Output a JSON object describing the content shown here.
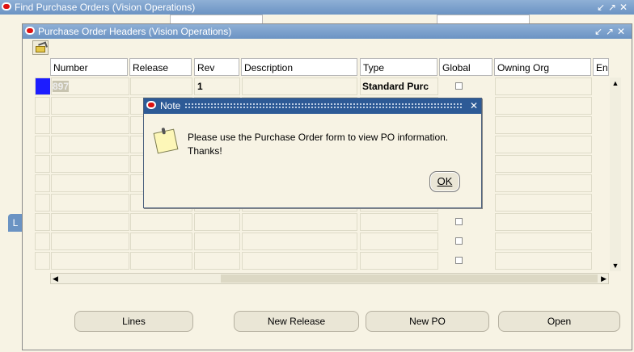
{
  "find_window": {
    "title": "Find Purchase Orders (Vision Operations)",
    "partial_value": "897"
  },
  "main_window": {
    "title": "Purchase Order Headers (Vision Operations)",
    "columns": [
      "Number",
      "Release",
      "Rev",
      "Description",
      "Type",
      "Global",
      "Owning Org",
      "En"
    ],
    "row1": {
      "number": "897",
      "rev": "1",
      "type": "Standard Purc"
    },
    "buttons": {
      "lines": "Lines",
      "new_release": "New Release",
      "new_po": "New PO",
      "open": "Open"
    }
  },
  "left_tab_label": "L",
  "dialog": {
    "title": "Note",
    "message_line1": "Please use the Purchase Order form to view PO information.",
    "message_line2": "Thanks!",
    "ok": "OK"
  },
  "colors": {
    "titlebar": "#6b93c3",
    "dialog_titlebar": "#2d5a96",
    "form_bg": "#f7f3e4",
    "selected_row": "#1c1cff"
  }
}
